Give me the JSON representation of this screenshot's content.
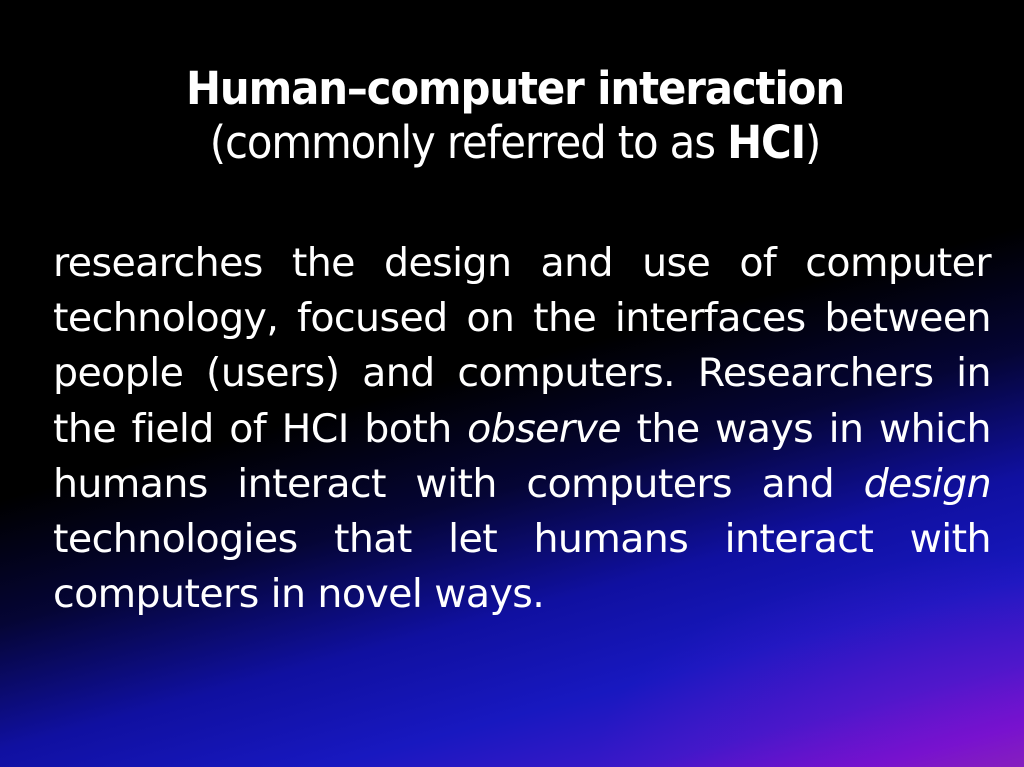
{
  "slide": {
    "title": {
      "line1": "Human–computer interaction",
      "line2_prefix": "(commonly referred to as ",
      "line2_bold": "HCI",
      "line2_suffix": ")"
    },
    "body": {
      "part1": "researches the design and use of computer technology, focused on the interfaces between people (users) and computers. Researchers in the field of HCI both ",
      "italic1": "observe",
      "part2": " the ways in which humans interact with computers and ",
      "italic2": "design",
      "part3": " technologies that let humans interact with computers in novel ways."
    },
    "colors": {
      "text": "#ffffff",
      "background_top": "#000000",
      "background_blue": "#1818c0",
      "background_purple": "#7010cc"
    }
  }
}
